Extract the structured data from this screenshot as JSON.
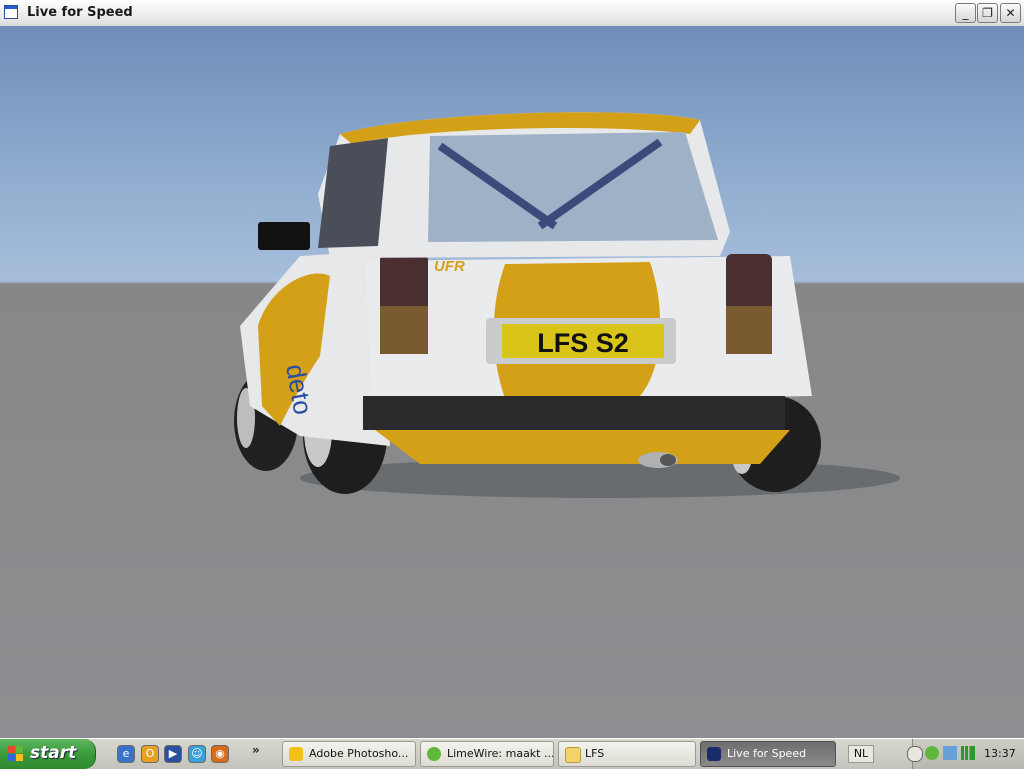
{
  "window": {
    "title": "Live for Speed",
    "minimize_label": "_",
    "maximize_label": "❐",
    "close_label": "✕"
  },
  "scene": {
    "license_plate": "LFS S2",
    "sticker_brand": "UFR",
    "side_text": "deto",
    "colors": {
      "body": "#e8eaec",
      "stripe": "#d4a017",
      "plate": "#d9c41a",
      "sky": "#8aa6cb",
      "ground": "#8a8c90"
    }
  },
  "taskbar": {
    "start_label": "start",
    "quicklaunch": [
      {
        "icon": "ie-icon",
        "glyph": "e"
      },
      {
        "icon": "outlook-icon",
        "glyph": "O"
      },
      {
        "icon": "media-player-icon",
        "glyph": "▶"
      },
      {
        "icon": "messenger-icon",
        "glyph": "☺"
      },
      {
        "icon": "firefox-icon",
        "glyph": "◉"
      }
    ],
    "overflow": "»",
    "tasks": [
      {
        "label": "Adobe Photosho...",
        "icon": "photoshop-icon",
        "active": false
      },
      {
        "label": "LimeWire: maakt ...",
        "icon": "limewire-icon",
        "active": false
      },
      {
        "label": "LFS",
        "icon": "folder-icon",
        "active": false
      },
      {
        "label": "Live for Speed",
        "icon": "lfs-icon",
        "active": true
      }
    ],
    "language": "NL",
    "clock": "13:37"
  }
}
